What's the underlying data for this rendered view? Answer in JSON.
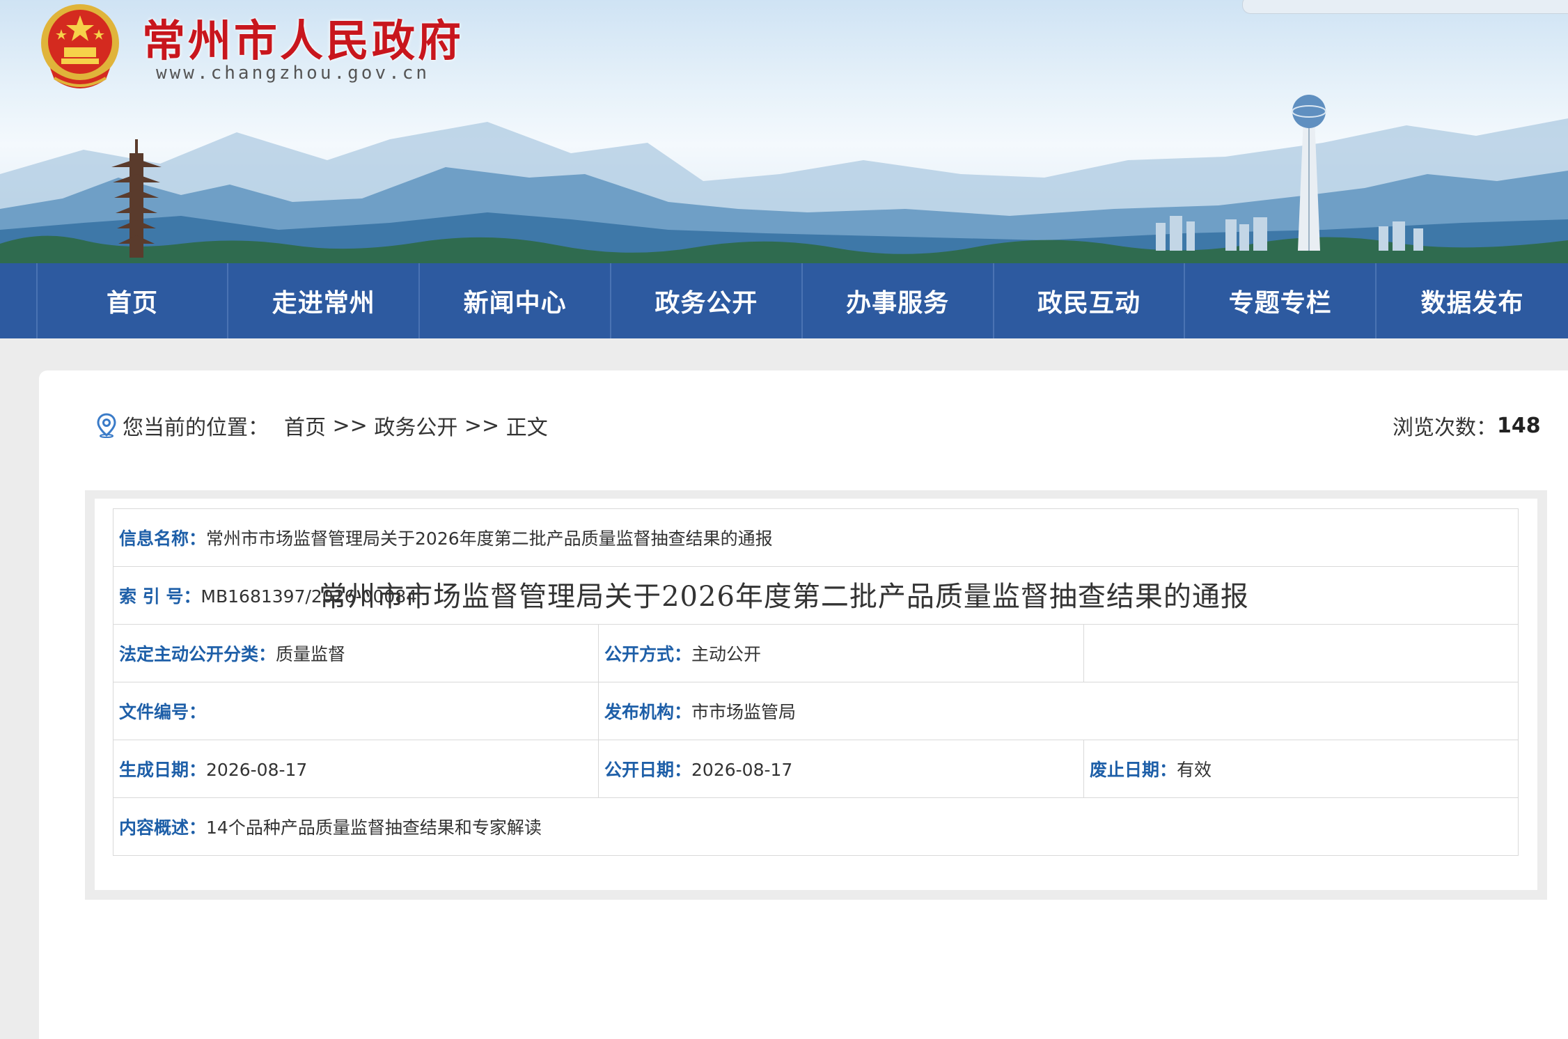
{
  "site": {
    "title": "常州市人民政府",
    "url": "www.changzhou.gov.cn"
  },
  "nav": {
    "items": [
      {
        "label": "首页"
      },
      {
        "label": "走进常州"
      },
      {
        "label": "新闻中心"
      },
      {
        "label": "政务公开"
      },
      {
        "label": "办事服务"
      },
      {
        "label": "政民互动"
      },
      {
        "label": "专题专栏"
      },
      {
        "label": "数据发布"
      }
    ]
  },
  "breadcrumb": {
    "prefix": "您当前的位置：",
    "home": "首页",
    "sep1": " >> ",
    "section": "政务公开",
    "sep2": " >> ",
    "current": "正文"
  },
  "views": {
    "label": "浏览次数：",
    "count": "148"
  },
  "info": {
    "name_label": "信息名称：",
    "name_value": "常州市市场监督管理局关于2026年度第二批产品质量监督抽查结果的通报",
    "index_label": "索 引 号：",
    "index_value": "MB1681397/2026-00084",
    "category_label": "法定主动公开分类：",
    "category_value": "质量监督",
    "method_label": "公开方式：",
    "method_value": "主动公开",
    "docno_label": "文件编号：",
    "docno_value": "",
    "publisher_label": "发布机构：",
    "publisher_value": "市市场监管局",
    "created_label": "生成日期：",
    "created_value": "2026-08-17",
    "published_label": "公开日期：",
    "published_value": "2026-08-17",
    "expiry_label": "废止日期：",
    "expiry_value": "有效",
    "summary_label": "内容概述：",
    "summary_value": "14个品种产品质量监督抽查结果和专家解读"
  },
  "document": {
    "title": "常州市市场监督管理局关于2026年度第二批产品质量监督抽查结果的通报"
  },
  "colors": {
    "nav_bg": "#2d5aa0",
    "title_red": "#c8161d",
    "label_blue": "#1e5fa8",
    "page_bg": "#ececec"
  },
  "icons": {
    "emblem": "national-emblem",
    "location": "location-pin-icon"
  }
}
